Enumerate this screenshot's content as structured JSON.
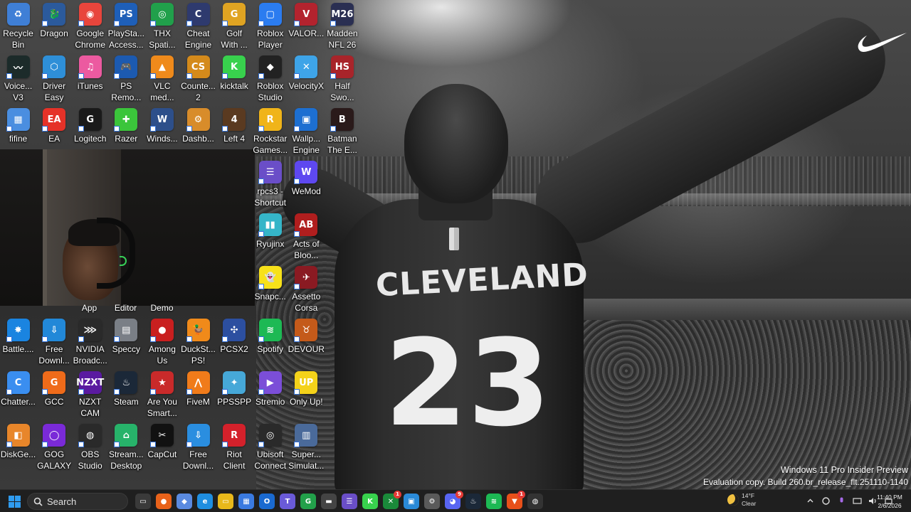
{
  "desktop": {
    "icons": [
      {
        "label": "Recycle\nBin",
        "color": "#3f7fd6",
        "glyph": "♻",
        "col": 0,
        "row": 0
      },
      {
        "label": "Dragon",
        "color": "#2b5a9c",
        "glyph": "🐉",
        "col": 1,
        "row": 0
      },
      {
        "label": "Google\nChrome",
        "color": "#e8453c",
        "glyph": "◉",
        "col": 2,
        "row": 0
      },
      {
        "label": "PlaySta...\nAccess...",
        "color": "#1e5fb8",
        "glyph": "PS",
        "col": 3,
        "row": 0
      },
      {
        "label": "THX\nSpati...",
        "color": "#21a04b",
        "glyph": "◎",
        "col": 4,
        "row": 0
      },
      {
        "label": "Cheat\nEngine",
        "color": "#2e3a6e",
        "glyph": "C",
        "col": 5,
        "row": 0
      },
      {
        "label": "Golf\nWith ...",
        "color": "#e0a422",
        "glyph": "G",
        "col": 6,
        "row": 0
      },
      {
        "label": "Roblox\nPlayer",
        "color": "#2b7cf0",
        "glyph": "▢",
        "col": 7,
        "row": 0
      },
      {
        "label": "VALOR...",
        "color": "#b3232e",
        "glyph": "V",
        "col": 8,
        "row": 0
      },
      {
        "label": "Madden\nNFL 26",
        "color": "#2a2f52",
        "glyph": "M26",
        "col": 9,
        "row": 0
      },
      {
        "label": "Voice...\nV3",
        "color": "#1c2b2a",
        "glyph": "〰",
        "col": 0,
        "row": 1
      },
      {
        "label": "Driver\nEasy",
        "color": "#2e8fd8",
        "glyph": "⬡",
        "col": 1,
        "row": 1
      },
      {
        "label": "iTunes",
        "color": "#ec5aa0",
        "glyph": "♫",
        "col": 2,
        "row": 1
      },
      {
        "label": "PS\nRemo...",
        "color": "#1c5ab0",
        "glyph": "🎮",
        "col": 3,
        "row": 1
      },
      {
        "label": "VLC\nmed...",
        "color": "#ef8a1b",
        "glyph": "▲",
        "col": 4,
        "row": 1
      },
      {
        "label": "Counte...\n2",
        "color": "#d48a1b",
        "glyph": "CS",
        "col": 5,
        "row": 1
      },
      {
        "label": "kicktalk",
        "color": "#38d14d",
        "glyph": "K",
        "col": 6,
        "row": 1
      },
      {
        "label": "Roblox\nStudio",
        "color": "#222",
        "glyph": "◆",
        "col": 7,
        "row": 1
      },
      {
        "label": "VelocityX",
        "color": "#3ea4e8",
        "glyph": "✕",
        "col": 8,
        "row": 1
      },
      {
        "label": "Half\nSwo...",
        "color": "#a8242a",
        "glyph": "HS",
        "col": 9,
        "row": 1
      },
      {
        "label": "fifine",
        "color": "#4a8ee0",
        "glyph": "▦",
        "col": 0,
        "row": 2
      },
      {
        "label": "EA",
        "color": "#e53228",
        "glyph": "EA",
        "col": 1,
        "row": 2
      },
      {
        "label": "Logitech",
        "color": "#1a1a1a",
        "glyph": "G",
        "col": 2,
        "row": 2
      },
      {
        "label": "Razer",
        "color": "#3bc53b",
        "glyph": "✚",
        "col": 3,
        "row": 2
      },
      {
        "label": "Winds...",
        "color": "#2d4f8a",
        "glyph": "W",
        "col": 4,
        "row": 2
      },
      {
        "label": "Dashb...",
        "color": "#d88c2a",
        "glyph": "⚙",
        "col": 5,
        "row": 2
      },
      {
        "label": "Left 4",
        "color": "#5a3a20",
        "glyph": "4",
        "col": 6,
        "row": 2
      },
      {
        "label": "Rockstar\nGames...",
        "color": "#f0b419",
        "glyph": "R",
        "col": 7,
        "row": 2
      },
      {
        "label": "Wallp...\nEngine",
        "color": "#1d6fd1",
        "glyph": "▣",
        "col": 8,
        "row": 2
      },
      {
        "label": "Batman\nThe E...",
        "color": "#2a1a1a",
        "glyph": "B",
        "col": 9,
        "row": 2
      },
      {
        "label": "rpcs3 -\nShortcut",
        "color": "#6a4ec8",
        "glyph": "☰",
        "col": 7,
        "row": 3
      },
      {
        "label": "WeMod",
        "color": "#5e48f0",
        "glyph": "W",
        "col": 8,
        "row": 3
      },
      {
        "label": "Ryujinx",
        "color": "#35b5c8",
        "glyph": "▮▮",
        "col": 7,
        "row": 4
      },
      {
        "label": "Acts of\nBloo...",
        "color": "#b01e1e",
        "glyph": "AB",
        "col": 8,
        "row": 4
      },
      {
        "label": "Snapc...",
        "color": "#f7e11a",
        "glyph": "👻",
        "col": 7,
        "row": 5
      },
      {
        "label": "Assetto\nCorsa",
        "color": "#8a1a22",
        "glyph": "✈",
        "col": 8,
        "row": 5
      },
      {
        "label": "Battle....",
        "color": "#1a84e0",
        "glyph": "✸",
        "col": 0,
        "row": 6
      },
      {
        "label": "Free\nDownl...",
        "color": "#2288d8",
        "glyph": "⇩",
        "col": 1,
        "row": 6
      },
      {
        "label": "NVIDIA\nBroadc...",
        "color": "#2a2a2a",
        "glyph": "⋙",
        "col": 2,
        "row": 6
      },
      {
        "label": "Speccy",
        "color": "#7a7f86",
        "glyph": "▤",
        "col": 3,
        "row": 6
      },
      {
        "label": "Among\nUs",
        "color": "#c91f1f",
        "glyph": "●",
        "col": 4,
        "row": 6
      },
      {
        "label": "DuckSt...\nPS!",
        "color": "#f08a1a",
        "glyph": "🦆",
        "col": 5,
        "row": 6
      },
      {
        "label": "PCSX2",
        "color": "#2c4fa0",
        "glyph": "✣",
        "col": 6,
        "row": 6
      },
      {
        "label": "Spotify",
        "color": "#1db954",
        "glyph": "≋",
        "col": 7,
        "row": 6
      },
      {
        "label": "DEVOUR",
        "color": "#c45a1a",
        "glyph": "♉",
        "col": 8,
        "row": 6
      },
      {
        "label": "Chatter...",
        "color": "#3a8ef0",
        "glyph": "C",
        "col": 0,
        "row": 7
      },
      {
        "label": "GCC",
        "color": "#ef6b1a",
        "glyph": "G",
        "col": 1,
        "row": 7
      },
      {
        "label": "NZXT\nCAM",
        "color": "#5a1aa0",
        "glyph": "NZXT",
        "col": 2,
        "row": 7
      },
      {
        "label": "Steam",
        "color": "#1b2838",
        "glyph": "♨",
        "col": 3,
        "row": 7
      },
      {
        "label": "Are You\nSmart...",
        "color": "#c92a2a",
        "glyph": "★",
        "col": 4,
        "row": 7
      },
      {
        "label": "FiveM",
        "color": "#f07b1a",
        "glyph": "⋀",
        "col": 5,
        "row": 7
      },
      {
        "label": "PPSSPP",
        "color": "#46a8d8",
        "glyph": "✦",
        "col": 6,
        "row": 7
      },
      {
        "label": "Stremio",
        "color": "#7b4ed8",
        "glyph": "▶",
        "col": 7,
        "row": 7
      },
      {
        "label": "Only Up!",
        "color": "#f4d21a",
        "glyph": "UP",
        "col": 8,
        "row": 7
      },
      {
        "label": "DiskGe...",
        "color": "#e8862a",
        "glyph": "◧",
        "col": 0,
        "row": 8
      },
      {
        "label": "GOG\nGALAXY",
        "color": "#7a2ad8",
        "glyph": "◯",
        "col": 1,
        "row": 8
      },
      {
        "label": "OBS\nStudio",
        "color": "#2a2a2a",
        "glyph": "◍",
        "col": 2,
        "row": 8
      },
      {
        "label": "Stream...\nDesktop",
        "color": "#27b36a",
        "glyph": "⌂",
        "col": 3,
        "row": 8
      },
      {
        "label": "CapCut",
        "color": "#111",
        "glyph": "✂",
        "col": 4,
        "row": 8
      },
      {
        "label": "Free\nDownl...",
        "color": "#2a8ee0",
        "glyph": "⇩",
        "col": 5,
        "row": 8
      },
      {
        "label": "Riot\nClient",
        "color": "#d4212b",
        "glyph": "R",
        "col": 6,
        "row": 8
      },
      {
        "label": "Ubisoft\nConnect",
        "color": "#2a2a2a",
        "glyph": "◎",
        "col": 7,
        "row": 8
      },
      {
        "label": "Super...\nSimulat...",
        "color": "#4a6a9a",
        "glyph": "▥",
        "col": 8,
        "row": 8
      }
    ],
    "obscured_labels": [
      "App",
      "Editor",
      "Demo"
    ]
  },
  "wallpaper": {
    "jersey_name": "CLEVELAND",
    "jersey_number": "23"
  },
  "watermark": {
    "line1": "Windows 11 Pro Insider Preview",
    "line2": "Evaluation copy. Build 260.br_release_flt.251110-1140"
  },
  "taskbar": {
    "search_placeholder": "Search",
    "apps": [
      {
        "name": "task-view",
        "color": "#3a3a3a",
        "glyph": "▭"
      },
      {
        "name": "firefox",
        "color": "#e8621a",
        "glyph": "●"
      },
      {
        "name": "copilot",
        "color": "#5a8ae0",
        "glyph": "◆"
      },
      {
        "name": "edge",
        "color": "#1f8ee0",
        "glyph": "e"
      },
      {
        "name": "file-explorer",
        "color": "#e8b81a",
        "glyph": "▭"
      },
      {
        "name": "microsoft-store",
        "color": "#3a7ae0",
        "glyph": "▦"
      },
      {
        "name": "outlook",
        "color": "#1a6ad0",
        "glyph": "O"
      },
      {
        "name": "teams",
        "color": "#6a5ad8",
        "glyph": "T"
      },
      {
        "name": "xbox-app",
        "color": "#22a04a",
        "glyph": "G"
      },
      {
        "name": "terminal",
        "color": "#444",
        "glyph": "▬"
      },
      {
        "name": "rpcs3",
        "color": "#6a4ec8",
        "glyph": "☰"
      },
      {
        "name": "kick",
        "color": "#38d14d",
        "glyph": "K"
      },
      {
        "name": "xbox",
        "color": "#1a8a3a",
        "glyph": "✕",
        "badge": "1"
      },
      {
        "name": "photos",
        "color": "#2a8ad8",
        "glyph": "▣"
      },
      {
        "name": "settings",
        "color": "#5a5a5a",
        "glyph": "⚙"
      },
      {
        "name": "discord",
        "color": "#5865f2",
        "glyph": "◕",
        "badge": "9"
      },
      {
        "name": "steam",
        "color": "#1b2838",
        "glyph": "♨"
      },
      {
        "name": "spotify",
        "color": "#1db954",
        "glyph": "≋"
      },
      {
        "name": "brave",
        "color": "#e8501a",
        "glyph": "▼",
        "badge": "1"
      },
      {
        "name": "obs",
        "color": "#333",
        "glyph": "◍"
      }
    ],
    "weather": {
      "temp": "14°F",
      "condition": "Clear"
    },
    "clock": {
      "time": "11:40 PM",
      "date": "2/6/2026"
    }
  }
}
